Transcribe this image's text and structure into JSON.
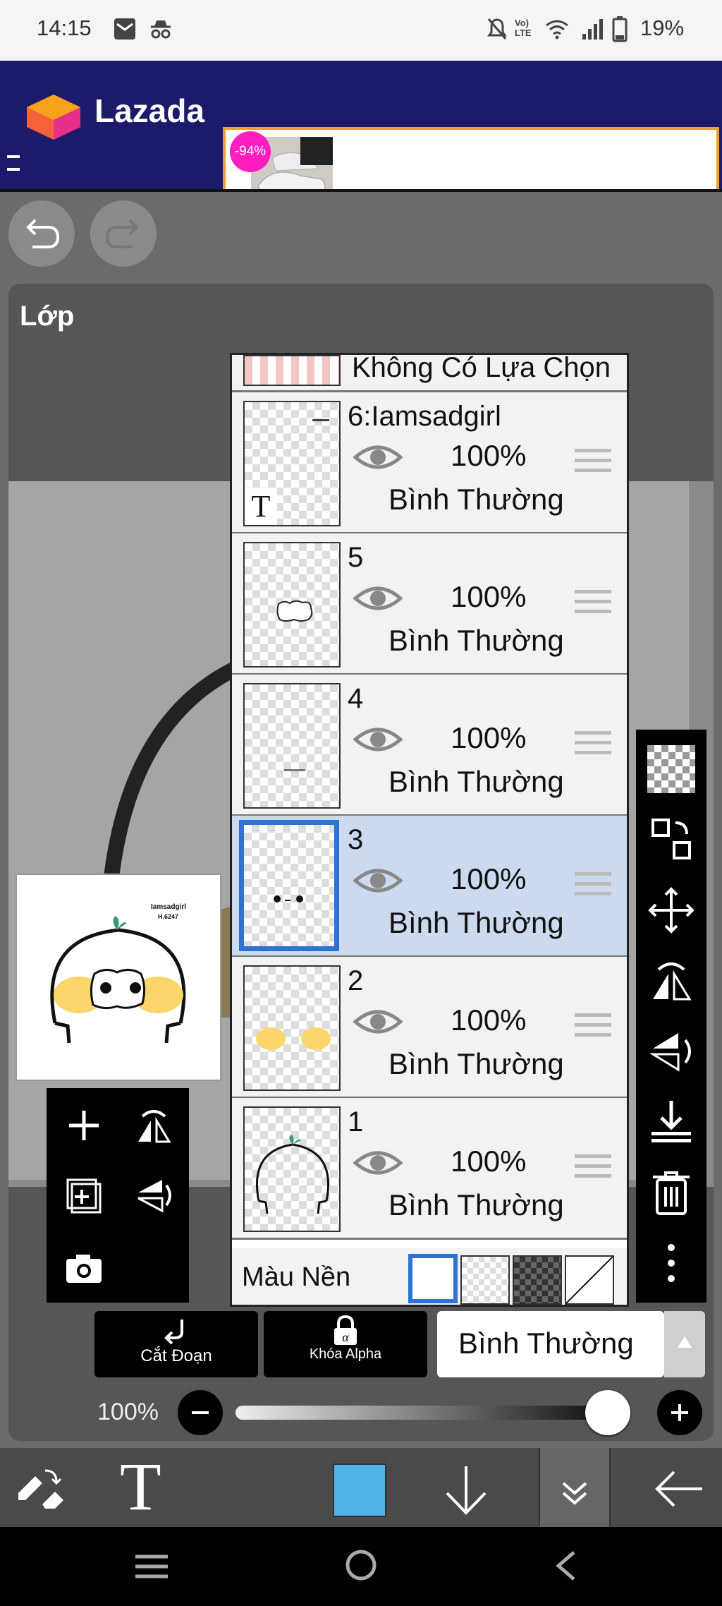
{
  "status_bar": {
    "time": "14:15",
    "lte_label": "LTE",
    "battery": "19%"
  },
  "ad": {
    "brand": "Lazada",
    "discount": "-94%"
  },
  "panel": {
    "title": "Lớp"
  },
  "no_selection_label": "Không Có Lựa Chọn",
  "layers": [
    {
      "name": "6:Iamsadgirl",
      "opacity": "100%",
      "blend": "Bình Thường",
      "thumb_text": "T",
      "selected": false
    },
    {
      "name": "5",
      "opacity": "100%",
      "blend": "Bình Thường",
      "selected": false
    },
    {
      "name": "4",
      "opacity": "100%",
      "blend": "Bình Thường",
      "selected": false
    },
    {
      "name": "3",
      "opacity": "100%",
      "blend": "Bình Thường",
      "selected": true
    },
    {
      "name": "2",
      "opacity": "100%",
      "blend": "Bình Thường",
      "selected": false
    },
    {
      "name": "1",
      "opacity": "100%",
      "blend": "Bình Thường",
      "selected": false
    }
  ],
  "background_row": {
    "label": "Màu Nền"
  },
  "bottom_controls": {
    "clip_label": "Cắt Đoạn",
    "alpha_lock_label": "Khóa Alpha",
    "blend_mode": "Bình Thường",
    "opacity_label": "100%",
    "opacity_value": 1.0
  },
  "preview_text": {
    "line1": "Iamsadgirl",
    "line2": "H.6247"
  },
  "colors": {
    "accent_blue": "#2f72d6",
    "current_color": "#4fb3e8",
    "selected_row": "#ccd9ee",
    "ad_bg": "#1b1a6b"
  }
}
